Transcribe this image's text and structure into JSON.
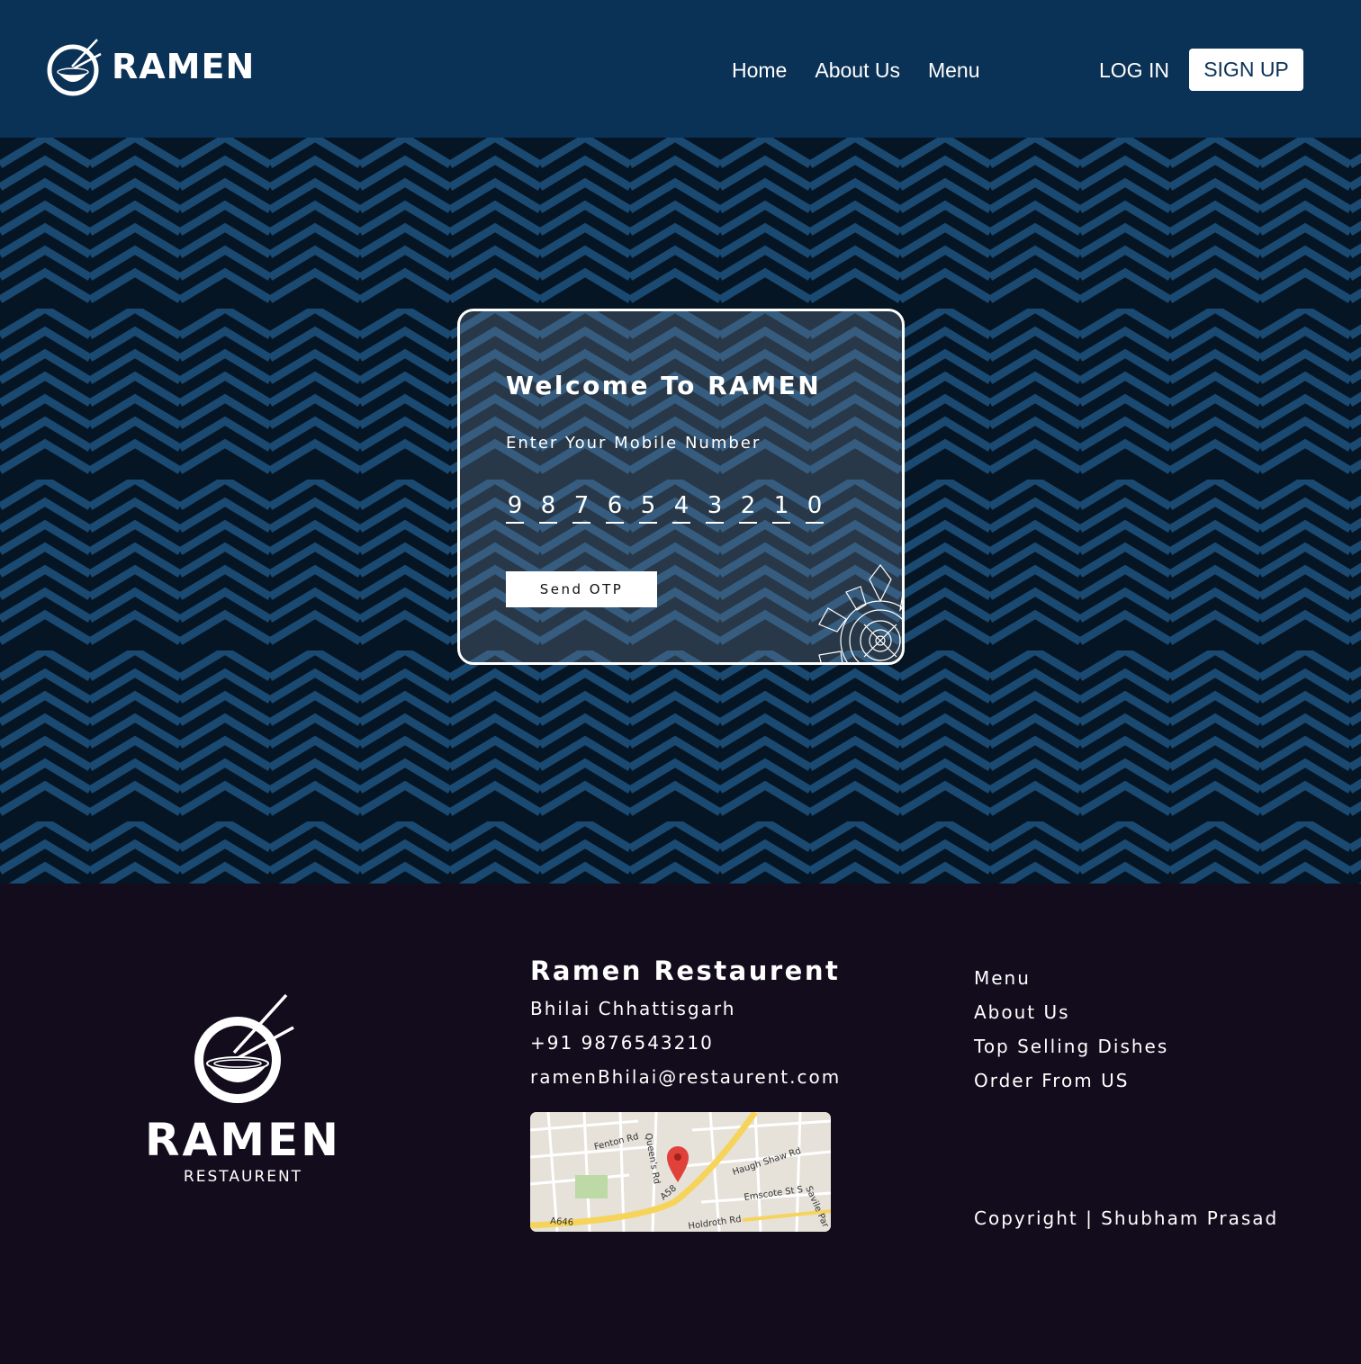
{
  "colors": {
    "header_bg": "#0a3156",
    "hero_bg": "#061523",
    "pattern": "#1a4a72",
    "footer_bg": "#120c1c",
    "accent_white": "#ffffff"
  },
  "header": {
    "brand": "RAMEN",
    "nav": [
      "Home",
      "About Us",
      "Menu"
    ],
    "login": "LOG IN",
    "signup": "SIGN UP"
  },
  "card": {
    "title": "Welcome To RAMEN",
    "label": "Enter Your Mobile Number",
    "digits": [
      "9",
      "8",
      "7",
      "6",
      "5",
      "4",
      "3",
      "2",
      "1",
      "0"
    ],
    "button": "Send OTP"
  },
  "footer": {
    "logo_word": "RAMEN",
    "logo_sub": "RESTAURENT",
    "name": "Ramen Restaurent",
    "location": "Bhilai Chhattisgarh",
    "phone": "+91 9876543210",
    "email": "ramenBhilai@restaurent.com",
    "links": [
      "Menu",
      "About Us",
      "Top Selling Dishes",
      "Order From US"
    ],
    "copyright": "Copyright | Shubham Prasad",
    "map_labels": {
      "fenton": "Fenton Rd",
      "queens": "Queen's Rd",
      "haugh": "Haugh Shaw Rd",
      "emscote": "Emscote St S",
      "savile": "Savile Par",
      "a58": "A58",
      "a646": "A646",
      "holdroth": "Holdroth Rd"
    }
  }
}
